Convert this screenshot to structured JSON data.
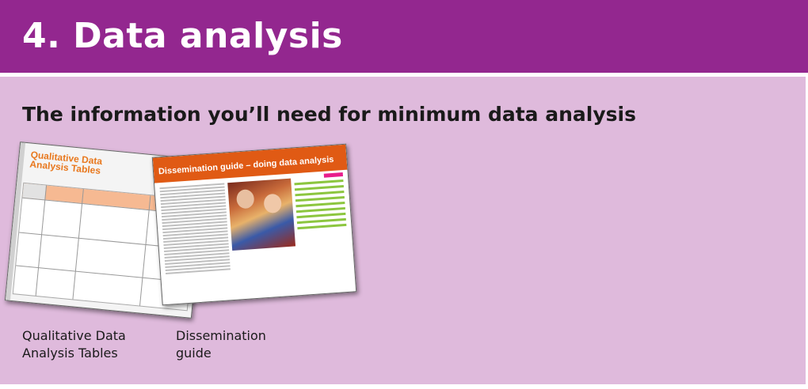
{
  "header": {
    "title": "4. Data analysis",
    "bg_color": "#93278f"
  },
  "panel": {
    "bg_color": "#dfbadc",
    "subtitle": "The information you’ll need for minimum data analysis"
  },
  "resources": [
    {
      "caption": "Qualitative Data Analysis Tables",
      "thumb_title": "Qualitative Data Analysis Tables"
    },
    {
      "caption": "Dissemination guide",
      "thumb_title": "Dissemination guide – doing data analysis"
    }
  ],
  "colors": {
    "accent_orange": "#e05a14",
    "accent_green": "#8cc63f"
  }
}
